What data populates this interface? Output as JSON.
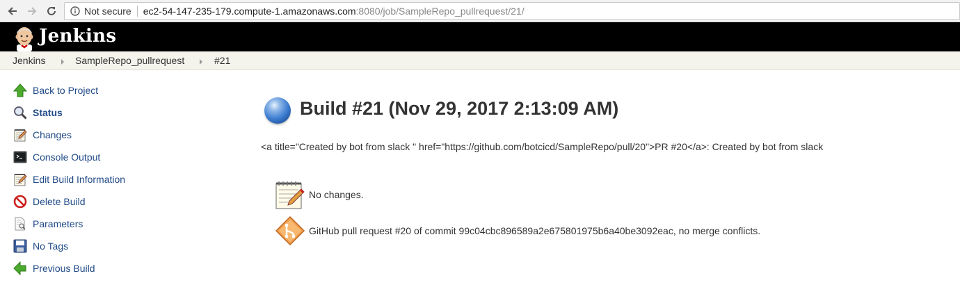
{
  "browser": {
    "security_label": "Not secure",
    "url_host": "ec2-54-147-235-179.compute-1.amazonaws.com",
    "url_path": ":8080/job/SampleRepo_pullrequest/21/"
  },
  "header": {
    "title": "Jenkins"
  },
  "breadcrumb": [
    "Jenkins",
    "SampleRepo_pullrequest",
    "#21"
  ],
  "sidebar": {
    "items": [
      {
        "label": "Back to Project",
        "icon": "up-arrow-icon"
      },
      {
        "label": "Status",
        "icon": "magnifier-icon",
        "active": true
      },
      {
        "label": "Changes",
        "icon": "notepad-icon"
      },
      {
        "label": "Console Output",
        "icon": "terminal-icon"
      },
      {
        "label": "Edit Build Information",
        "icon": "notepad-icon"
      },
      {
        "label": "Delete Build",
        "icon": "no-entry-icon"
      },
      {
        "label": "Parameters",
        "icon": "document-search-icon"
      },
      {
        "label": "No Tags",
        "icon": "floppy-icon"
      },
      {
        "label": "Previous Build",
        "icon": "left-arrow-icon"
      }
    ]
  },
  "main": {
    "build_title": "Build #21 (Nov 29, 2017 2:13:09 AM)",
    "description": "<a title=\"Created by bot from slack \" href=\"https://github.com/botcicd/SampleRepo/pull/20\">PR #20</a>: Created by bot from slack",
    "changes_text": "No changes.",
    "pr_text": "GitHub pull request #20 of commit 99c04cbc896589a2e675801975b6a40be3092eac, no merge conflicts."
  },
  "colors": {
    "link": "#204a87",
    "header_bg": "#000000",
    "breadcrumb_bg": "#f4f4ec",
    "build_status": "#3d7dd1"
  }
}
